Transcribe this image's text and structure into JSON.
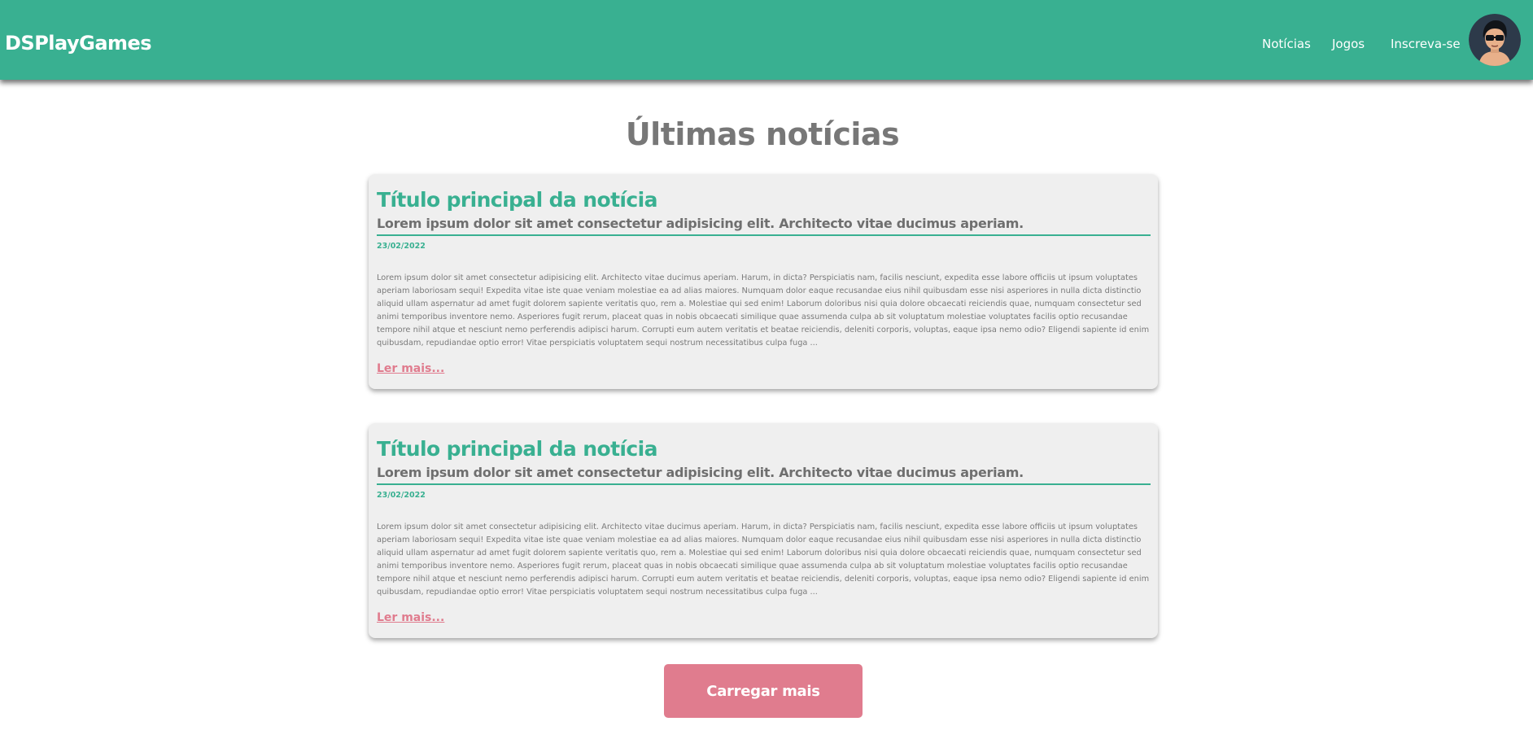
{
  "header": {
    "brand": "DSPlayGames",
    "nav": [
      "Notícias",
      "Jogos",
      "Inscreva-se"
    ],
    "avatar_icon": "user-avatar-icon"
  },
  "main": {
    "title": "Últimas notícias",
    "articles": [
      {
        "title": "Título principal da notícia",
        "subtitle": "Lorem ipsum dolor sit amet consectetur adipisicing elit. Architecto vitae ducimus aperiam.",
        "date": "23/02/2022",
        "body": "Lorem ipsum dolor sit amet consectetur adipisicing elit. Architecto vitae ducimus aperiam. Harum, in dicta? Perspiciatis nam, facilis nesciunt, expedita esse labore officiis ut ipsum voluptates aperiam laboriosam sequi! Expedita vitae iste quae veniam molestiae ea ad alias maiores. Numquam dolor eaque recusandae eius nihil quibusdam esse nisi asperiores in nulla dicta distinctio aliquid ullam aspernatur ad amet fugit dolorem sapiente veritatis quo, rem a. Molestiae qui sed enim! Laborum doloribus nisi quia dolore obcaecati reiciendis quae, numquam consectetur sed animi temporibus inventore nemo. Asperiores fugit rerum, placeat quas in nobis obcaecati similique quae assumenda culpa ab sit voluptatum molestiae voluptates facilis optio recusandae tempore nihil atque et nesciunt nemo perferendis adipisci harum. Corrupti eum autem veritatis et beatae reiciendis, deleniti corporis, voluptas, eaque ipsa nemo odio? Eligendi sapiente id enim quibusdam, repudiandae optio error! Vitae perspiciatis voluptatem sequi nostrum necessitatibus culpa fuga ...",
        "more": "Ler mais..."
      },
      {
        "title": "Título principal da notícia",
        "subtitle": "Lorem ipsum dolor sit amet consectetur adipisicing elit. Architecto vitae ducimus aperiam.",
        "date": "23/02/2022",
        "body": "Lorem ipsum dolor sit amet consectetur adipisicing elit. Architecto vitae ducimus aperiam. Harum, in dicta? Perspiciatis nam, facilis nesciunt, expedita esse labore officiis ut ipsum voluptates aperiam laboriosam sequi! Expedita vitae iste quae veniam molestiae ea ad alias maiores. Numquam dolor eaque recusandae eius nihil quibusdam esse nisi asperiores in nulla dicta distinctio aliquid ullam aspernatur ad amet fugit dolorem sapiente veritatis quo, rem a. Molestiae qui sed enim! Laborum doloribus nisi quia dolore obcaecati reiciendis quae, numquam consectetur sed animi temporibus inventore nemo. Asperiores fugit rerum, placeat quas in nobis obcaecati similique quae assumenda culpa ab sit voluptatum molestiae voluptates facilis optio recusandae tempore nihil atque et nesciunt nemo perferendis adipisci harum. Corrupti eum autem veritatis et beatae reiciendis, deleniti corporis, voluptas, eaque ipsa nemo odio? Eligendi sapiente id enim quibusdam, repudiandae optio error! Vitae perspiciatis voluptatem sequi nostrum necessitatibus culpa fuga ...",
        "more": "Ler mais..."
      }
    ],
    "load_more": "Carregar mais"
  },
  "colors": {
    "primary": "#39b091",
    "accent": "#e07c8e",
    "card_bg": "#efefef",
    "title_gray": "#777777"
  }
}
